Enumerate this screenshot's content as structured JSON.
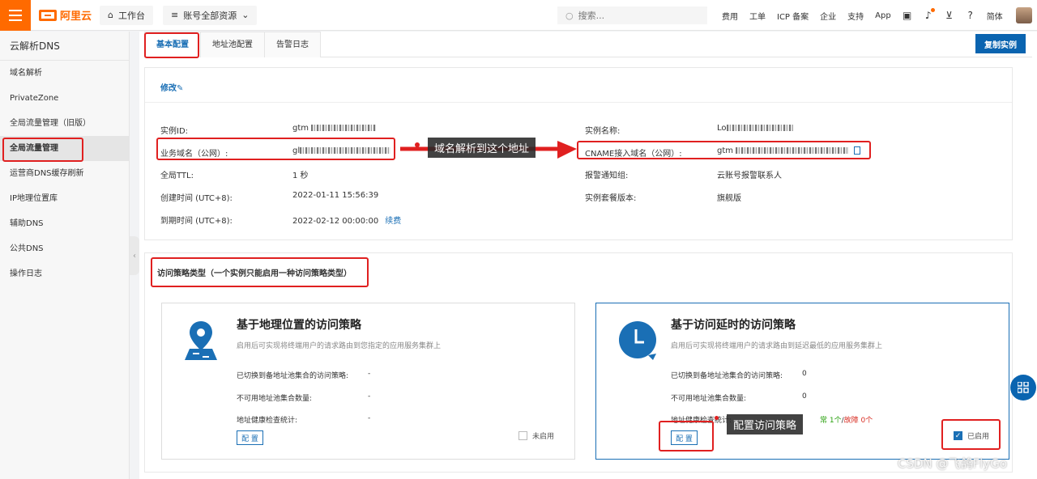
{
  "topbar": {
    "brand": "阿里云",
    "workbench": "工作台",
    "resources": "账号全部资源",
    "search_placeholder": "搜索...",
    "nav": [
      "费用",
      "工单",
      "ICP 备案",
      "企业",
      "支持",
      "App"
    ],
    "language": "简体"
  },
  "sidebar": {
    "title": "云解析DNS",
    "items": [
      {
        "label": "域名解析"
      },
      {
        "label": "PrivateZone"
      },
      {
        "label": "全局流量管理（旧版）"
      },
      {
        "label": "全局流量管理"
      },
      {
        "label": "运营商DNS缓存刷新"
      },
      {
        "label": "IP地理位置库"
      },
      {
        "label": "辅助DNS"
      },
      {
        "label": "公共DNS"
      },
      {
        "label": "操作日志"
      }
    ]
  },
  "tabs": [
    "基本配置",
    "地址池配置",
    "告警日志"
  ],
  "copy_instance": "复制实例",
  "info": {
    "edit": "修改",
    "instance_id_label": "实例ID:",
    "instance_id_value": "gtm",
    "service_domain_label": "业务域名（公网）:",
    "service_domain_value": "gl",
    "ttl_label": "全局TTL:",
    "ttl_value": "1 秒",
    "created_label": "创建时间 (UTC+8):",
    "created_value": "2022-01-11 15:56:39",
    "expire_label": "到期时间 (UTC+8):",
    "expire_value": "2022-02-12 00:00:00",
    "renew": "续费",
    "instance_name_label": "实例名称:",
    "instance_name_value": "Lo",
    "cname_label": "CNAME接入域名（公网）:",
    "cname_value": "gtm",
    "alarm_label": "报警通知组:",
    "alarm_value": "云账号报警联系人",
    "edition_label": "实例套餐版本:",
    "edition_value": "旗舰版"
  },
  "policy": {
    "heading": "访问策略类型（一个实例只能启用一种访问策略类型）",
    "geo": {
      "title": "基于地理位置的访问策略",
      "desc": "启用后可实现将终端用户的请求路由到您指定的应用服务集群上",
      "switched_label": "已切换到备地址池集合的访问策略:",
      "switched_value": "-",
      "unavailable_label": "不可用地址池集合数量:",
      "unavailable_value": "-",
      "health_label": "地址健康检查统计:",
      "health_value": "-",
      "config": "配 置",
      "enable": "未启用"
    },
    "latency": {
      "title": "基于访问延时的访问策略",
      "desc": "启用后可实现将终端用户的请求路由到延迟最低的应用服务集群上",
      "switched_label": "已切换到备地址池集合的访问策略:",
      "switched_value": "0",
      "unavailable_label": "不可用地址池集合数量:",
      "unavailable_value": "0",
      "health_label": "地址健康检查统计:",
      "health_normal": "常 1个",
      "health_sep": "/",
      "health_fault": "故障 0个",
      "config": "配 置",
      "enable": "已启用"
    }
  },
  "annotations": {
    "arrow_text": "域名解析到这个地址",
    "config_text": "配置访问策略"
  },
  "watermark": "CSDN @飞鸽FlyGo",
  "colors": {
    "brand": "#ff6a00",
    "primary": "#0a64b0",
    "annotation": "#e02020"
  }
}
